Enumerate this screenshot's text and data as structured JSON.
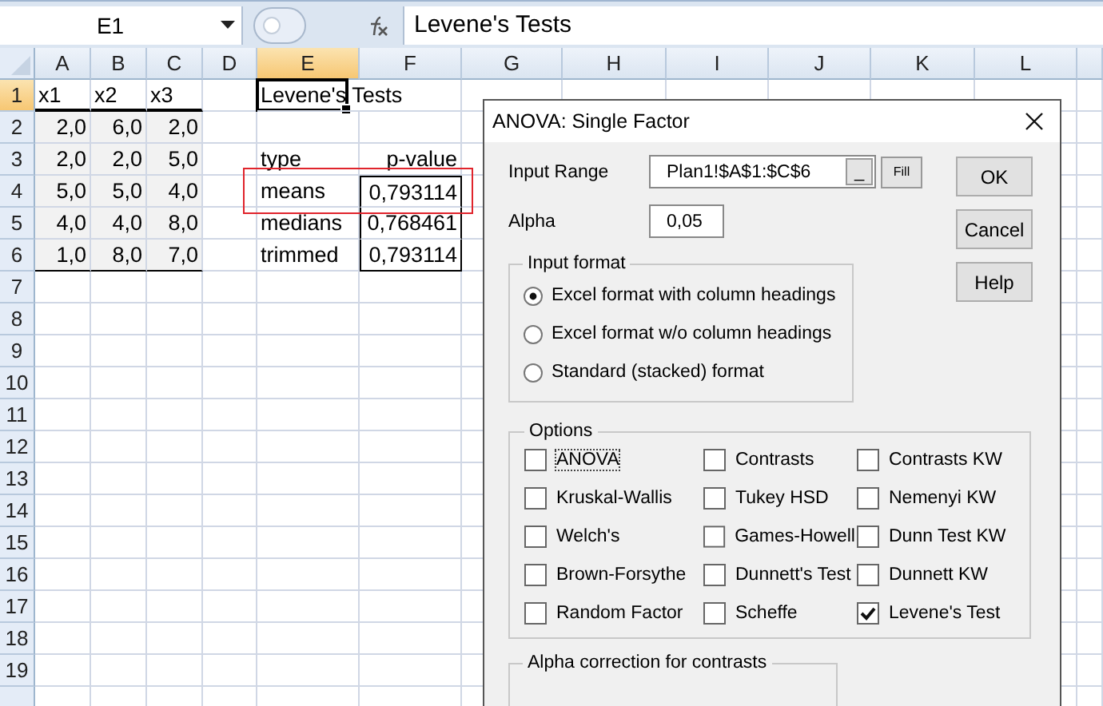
{
  "formula_bar": {
    "name_box": "E1",
    "formula": "Levene's Tests"
  },
  "columns": [
    {
      "label": "A",
      "selected": false
    },
    {
      "label": "B",
      "selected": false
    },
    {
      "label": "C",
      "selected": false
    },
    {
      "label": "D",
      "selected": false
    },
    {
      "label": "E",
      "selected": true
    },
    {
      "label": "F",
      "selected": false
    },
    {
      "label": "G",
      "selected": false
    },
    {
      "label": "H",
      "selected": false
    },
    {
      "label": "I",
      "selected": false
    },
    {
      "label": "J",
      "selected": false
    },
    {
      "label": "K",
      "selected": false
    },
    {
      "label": "L",
      "selected": false
    }
  ],
  "rows": [
    {
      "number": "1",
      "selected": true,
      "cells": [
        {
          "text": "x1",
          "kind": "text"
        },
        {
          "text": "x2",
          "kind": "text"
        },
        {
          "text": "x3",
          "kind": "text"
        },
        null,
        {
          "text": "Levene's Tests",
          "kind": "text",
          "overflow": true
        }
      ]
    },
    {
      "number": "2",
      "selected": false,
      "cells": [
        {
          "text": "2,0",
          "kind": "number"
        },
        {
          "text": "6,0",
          "kind": "number"
        },
        {
          "text": "2,0",
          "kind": "number"
        }
      ]
    },
    {
      "number": "3",
      "selected": false,
      "cells": [
        {
          "text": "2,0",
          "kind": "number"
        },
        {
          "text": "2,0",
          "kind": "number"
        },
        {
          "text": "5,0",
          "kind": "number"
        },
        null,
        {
          "text": "type",
          "kind": "text"
        },
        {
          "text": "p-value",
          "kind": "number"
        }
      ]
    },
    {
      "number": "4",
      "selected": false,
      "cells": [
        {
          "text": "5,0",
          "kind": "number"
        },
        {
          "text": "5,0",
          "kind": "number"
        },
        {
          "text": "4,0",
          "kind": "number"
        },
        null,
        {
          "text": "means",
          "kind": "text"
        },
        {
          "text": "0,793114",
          "kind": "number"
        }
      ]
    },
    {
      "number": "5",
      "selected": false,
      "cells": [
        {
          "text": "4,0",
          "kind": "number"
        },
        {
          "text": "4,0",
          "kind": "number"
        },
        {
          "text": "8,0",
          "kind": "number"
        },
        null,
        {
          "text": "medians",
          "kind": "text"
        },
        {
          "text": "0,768461",
          "kind": "number"
        }
      ]
    },
    {
      "number": "6",
      "selected": false,
      "cells": [
        {
          "text": "1,0",
          "kind": "number"
        },
        {
          "text": "8,0",
          "kind": "number"
        },
        {
          "text": "7,0",
          "kind": "number"
        },
        null,
        {
          "text": "trimmed",
          "kind": "text"
        },
        {
          "text": "0,793114",
          "kind": "number"
        }
      ]
    },
    {
      "number": "7",
      "selected": false
    },
    {
      "number": "8",
      "selected": false
    },
    {
      "number": "9",
      "selected": false
    },
    {
      "number": "10",
      "selected": false
    },
    {
      "number": "11",
      "selected": false
    },
    {
      "number": "12",
      "selected": false
    },
    {
      "number": "13",
      "selected": false
    },
    {
      "number": "14",
      "selected": false
    },
    {
      "number": "15",
      "selected": false
    },
    {
      "number": "16",
      "selected": false
    },
    {
      "number": "17",
      "selected": false
    },
    {
      "number": "18",
      "selected": false
    },
    {
      "number": "19",
      "selected": false
    },
    {
      "selected": false
    }
  ],
  "dialog": {
    "title": "ANOVA: Single Factor",
    "input_range_label": "Input Range",
    "input_range": "Plan1!$A$1:$C$6",
    "collapse_button": "_",
    "fill_button": "Fill",
    "alpha_label": "Alpha",
    "alpha": "0,05",
    "buttons": [
      "OK",
      "Cancel",
      "Help"
    ],
    "input_format": {
      "title": "Input format",
      "options": [
        {
          "label": "Excel format with column headings",
          "selected": true
        },
        {
          "label": "Excel format w/o column headings",
          "selected": false
        },
        {
          "label": "Standard (stacked) format",
          "selected": false
        }
      ]
    },
    "options": {
      "title": "Options",
      "items": [
        {
          "label": "ANOVA",
          "checked": false,
          "focused": true
        },
        {
          "label": "Contrasts",
          "checked": false,
          "focused": false
        },
        {
          "label": "Contrasts KW",
          "checked": false,
          "focused": false
        },
        {
          "label": "Kruskal-Wallis",
          "checked": false,
          "focused": false
        },
        {
          "label": "Tukey HSD",
          "checked": false,
          "focused": false
        },
        {
          "label": "Nemenyi KW",
          "checked": false,
          "focused": false
        },
        {
          "label": "Welch's",
          "checked": false,
          "focused": false
        },
        {
          "label": "Games-Howell",
          "checked": false,
          "focused": false
        },
        {
          "label": "Dunn Test KW",
          "checked": false,
          "focused": false
        },
        {
          "label": "Brown-Forsythe",
          "checked": false,
          "focused": false
        },
        {
          "label": "Dunnett's Test",
          "checked": false,
          "focused": false
        },
        {
          "label": "Dunnett KW",
          "checked": false,
          "focused": false
        },
        {
          "label": "Random Factor",
          "checked": false,
          "focused": false
        },
        {
          "label": "Scheffe",
          "checked": false,
          "focused": false
        },
        {
          "label": "Levene's Test",
          "checked": true,
          "focused": false
        }
      ]
    },
    "alpha_correction": {
      "title": "Alpha correction for contrasts"
    }
  }
}
